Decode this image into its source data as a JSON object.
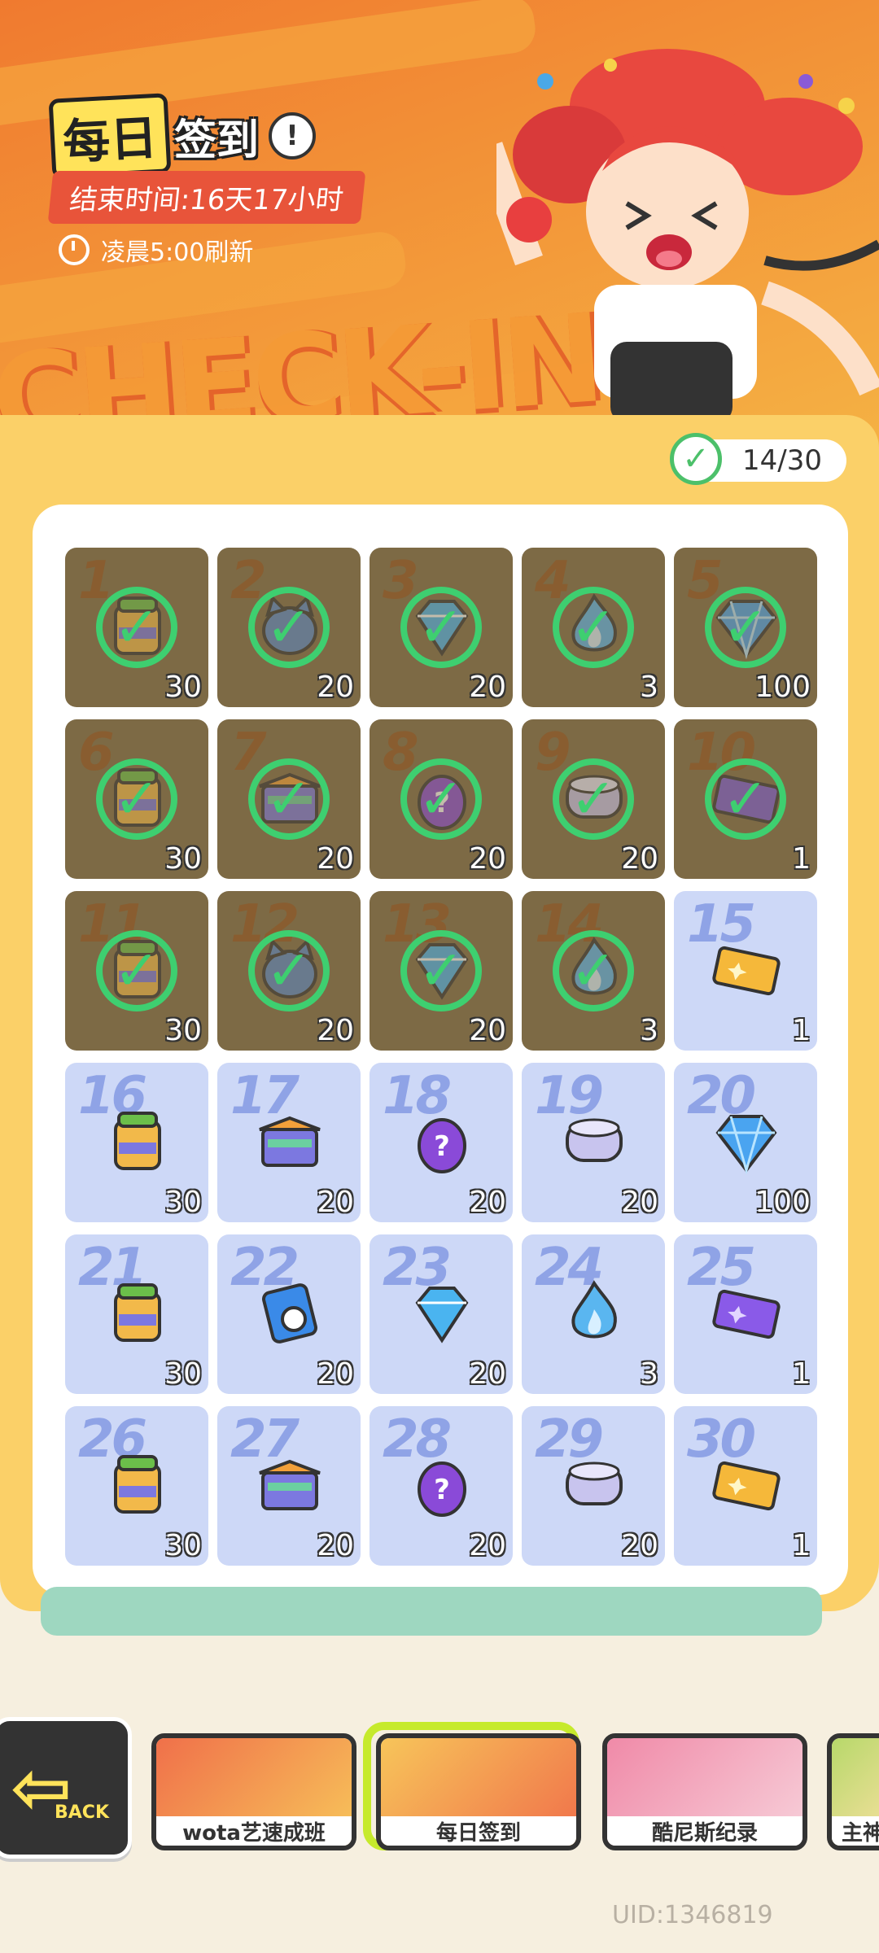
{
  "header": {
    "title_part1": "每日",
    "title_part2": "签到",
    "info_icon": "!",
    "end_time": "结束时间:16天17小时",
    "refresh_text": "凌晨5:00刷新",
    "banner_text": "CHECK-IN"
  },
  "progress": {
    "text": "14/30",
    "icon": "check-circle-icon"
  },
  "days": [
    {
      "day": "1",
      "qty": "30",
      "claimed": true,
      "item": "jar-icon"
    },
    {
      "day": "2",
      "qty": "20",
      "claimed": true,
      "item": "cat-icon"
    },
    {
      "day": "3",
      "qty": "20",
      "claimed": true,
      "item": "gem-icon"
    },
    {
      "day": "4",
      "qty": "3",
      "claimed": true,
      "item": "flame-icon"
    },
    {
      "day": "5",
      "qty": "100",
      "claimed": true,
      "item": "diamond-icon"
    },
    {
      "day": "6",
      "qty": "30",
      "claimed": true,
      "item": "jar-icon"
    },
    {
      "day": "7",
      "qty": "20",
      "claimed": true,
      "item": "box-icon"
    },
    {
      "day": "8",
      "qty": "20",
      "claimed": true,
      "item": "egg-icon"
    },
    {
      "day": "9",
      "qty": "20",
      "claimed": true,
      "item": "can-icon"
    },
    {
      "day": "10",
      "qty": "1",
      "claimed": true,
      "item": "ticket-icon"
    },
    {
      "day": "11",
      "qty": "30",
      "claimed": true,
      "item": "jar-icon"
    },
    {
      "day": "12",
      "qty": "20",
      "claimed": true,
      "item": "cat-icon"
    },
    {
      "day": "13",
      "qty": "20",
      "claimed": true,
      "item": "gem-icon"
    },
    {
      "day": "14",
      "qty": "3",
      "claimed": true,
      "item": "flame-icon"
    },
    {
      "day": "15",
      "qty": "1",
      "claimed": false,
      "item": "gold-ticket-icon"
    },
    {
      "day": "16",
      "qty": "30",
      "claimed": false,
      "item": "jar-icon"
    },
    {
      "day": "17",
      "qty": "20",
      "claimed": false,
      "item": "box-icon"
    },
    {
      "day": "18",
      "qty": "20",
      "claimed": false,
      "item": "egg-icon"
    },
    {
      "day": "19",
      "qty": "20",
      "claimed": false,
      "item": "can-icon"
    },
    {
      "day": "20",
      "qty": "100",
      "claimed": false,
      "item": "diamond-icon"
    },
    {
      "day": "21",
      "qty": "30",
      "claimed": false,
      "item": "jar-icon"
    },
    {
      "day": "22",
      "qty": "20",
      "claimed": false,
      "item": "tape-icon"
    },
    {
      "day": "23",
      "qty": "20",
      "claimed": false,
      "item": "gem-icon"
    },
    {
      "day": "24",
      "qty": "3",
      "claimed": false,
      "item": "flame-icon"
    },
    {
      "day": "25",
      "qty": "1",
      "claimed": false,
      "item": "purple-ticket-icon"
    },
    {
      "day": "26",
      "qty": "30",
      "claimed": false,
      "item": "jar-icon"
    },
    {
      "day": "27",
      "qty": "20",
      "claimed": false,
      "item": "box-icon"
    },
    {
      "day": "28",
      "qty": "20",
      "claimed": false,
      "item": "egg-icon"
    },
    {
      "day": "29",
      "qty": "20",
      "claimed": false,
      "item": "can-icon"
    },
    {
      "day": "30",
      "qty": "1",
      "claimed": false,
      "item": "gold-ticket-icon"
    }
  ],
  "nav": {
    "back_label": "BACK",
    "tabs": [
      {
        "label": "wota艺速成班",
        "active": false,
        "color": "#f07a5a"
      },
      {
        "label": "每日签到",
        "active": true,
        "color": "#f5b445"
      },
      {
        "label": "酷尼斯纪录",
        "active": false,
        "color": "#f4a6b8"
      },
      {
        "label": "主神",
        "active": false,
        "color": "#b7d86a"
      }
    ]
  },
  "footer": {
    "uid": "UID:1346819"
  },
  "colors": {
    "claimed_bg": "#7d6a45",
    "unclaimed_bg": "#cdd8f7",
    "check_green": "#3ecf70",
    "card_yellow": "#fbd068",
    "active_tab_frame": "#c6ea2c"
  }
}
